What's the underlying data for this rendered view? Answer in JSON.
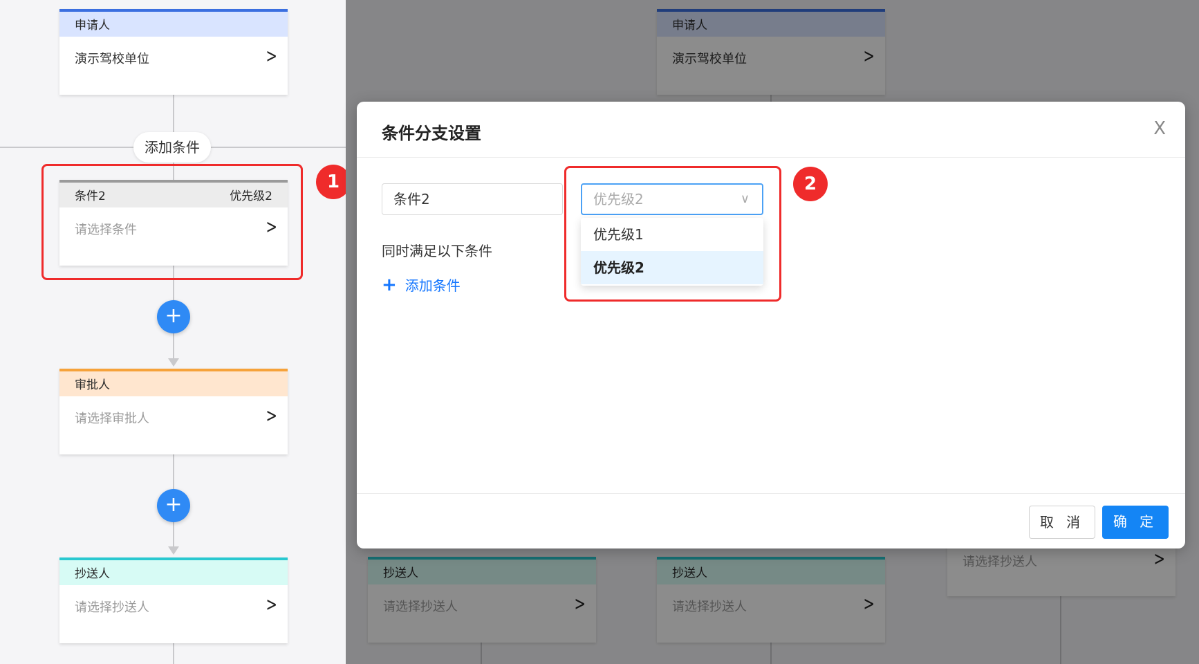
{
  "left_flow": {
    "applicant": {
      "title": "申请人",
      "value": "演示驾校单位"
    },
    "add_condition_pill": "添加条件",
    "condition": {
      "title": "条件2",
      "priority": "优先级2",
      "placeholder": "请选择条件"
    },
    "approver": {
      "title": "审批人",
      "placeholder": "请选择审批人"
    },
    "cc": {
      "title": "抄送人",
      "placeholder": "请选择抄送人"
    }
  },
  "background_flow": {
    "applicant": {
      "title": "申请人",
      "value": "演示驾校单位"
    },
    "cc_cards": [
      {
        "title": "抄送人",
        "placeholder": "请选择抄送人"
      },
      {
        "title": "抄送人",
        "placeholder": "请选择抄送人"
      }
    ],
    "right_card_placeholder": "请选择抄送人"
  },
  "modal": {
    "title": "条件分支设置",
    "close": "X",
    "name_value": "条件2",
    "select_value": "优先级2",
    "options": [
      "优先级1",
      "优先级2"
    ],
    "selected_option": "优先级2",
    "condition_label": "同时满足以下条件",
    "add_condition": "添加条件",
    "cancel": "取 消",
    "confirm": "确 定"
  },
  "annotations": {
    "badge1": "1",
    "badge2": "2"
  },
  "colors": {
    "accent": "#1485f5",
    "highlight": "#ef2b2b"
  }
}
